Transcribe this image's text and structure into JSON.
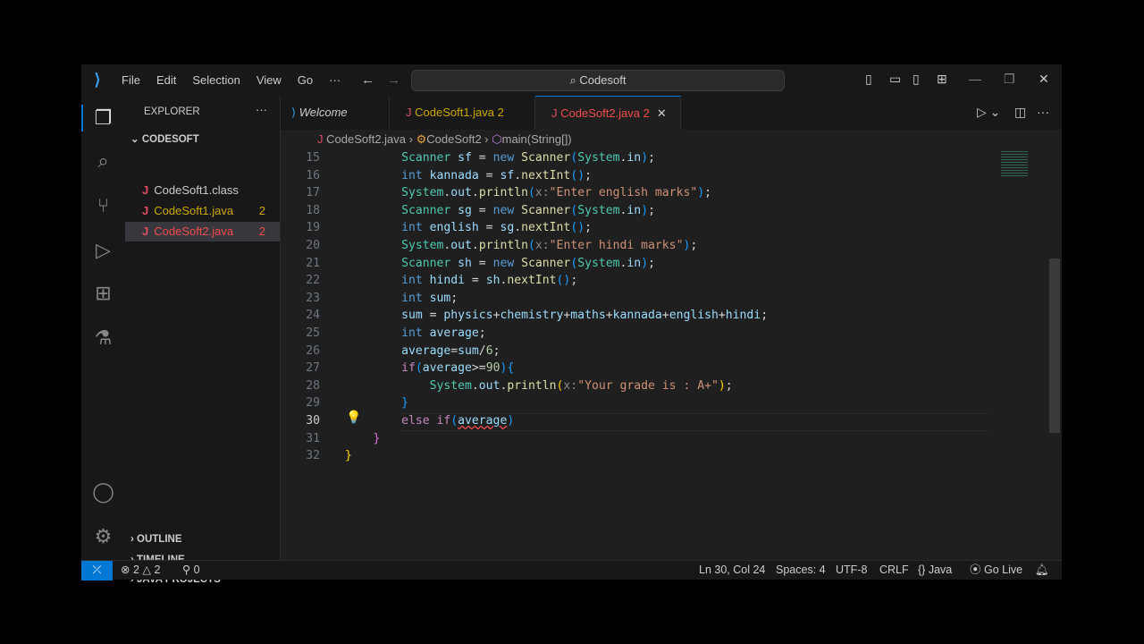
{
  "title_bar": {
    "menus": [
      "File",
      "Edit",
      "Selection",
      "View",
      "Go",
      "···"
    ],
    "search": "Codesoft"
  },
  "sidebar": {
    "title": "EXPLORER",
    "folder": "CODESOFT",
    "files": [
      {
        "name": "CodeSoft1.class",
        "badge": "",
        "color": "#cccccc"
      },
      {
        "name": "CodeSoft1.java",
        "badge": "2",
        "color": "#cca700"
      },
      {
        "name": "CodeSoft2.java",
        "badge": "2",
        "color": "#f14c4c",
        "selected": true
      }
    ],
    "sections": [
      "OUTLINE",
      "TIMELINE",
      "JAVA PROJECTS"
    ]
  },
  "tabs": [
    {
      "label": "Welcome",
      "badge": ""
    },
    {
      "label": "CodeSoft1.java",
      "badge": "2"
    },
    {
      "label": "CodeSoft2.java",
      "badge": "2"
    }
  ],
  "breadcrumb": {
    "file": "CodeSoft2.java",
    "cls": "CodeSoft2",
    "method": "main(String[])"
  },
  "editor": {
    "current_line": 30,
    "lines": [
      {
        "n": "15",
        "t": [
          [
            "ty",
            "        Scanner "
          ],
          [
            "va",
            "sf"
          ],
          [
            "pl",
            " = "
          ],
          [
            "kw",
            "new "
          ],
          [
            "fn",
            "Scanner"
          ],
          [
            "br3",
            "("
          ],
          [
            "ty",
            "System"
          ],
          [
            "pl",
            "."
          ],
          [
            "va",
            "in"
          ],
          [
            "br3",
            ")"
          ],
          [
            "pl",
            ";"
          ]
        ]
      },
      {
        "n": "16",
        "t": [
          [
            "kw",
            "        int "
          ],
          [
            "va",
            "kannada"
          ],
          [
            "pl",
            " = "
          ],
          [
            "va",
            "sf"
          ],
          [
            "pl",
            "."
          ],
          [
            "fn",
            "nextInt"
          ],
          [
            "br3",
            "()"
          ],
          [
            "pl",
            ";"
          ]
        ]
      },
      {
        "n": "17",
        "t": [
          [
            "ty",
            "        System"
          ],
          [
            "pl",
            "."
          ],
          [
            "va",
            "out"
          ],
          [
            "pl",
            "."
          ],
          [
            "fn",
            "println"
          ],
          [
            "br3",
            "("
          ],
          [
            "hint",
            "x:"
          ],
          [
            "st",
            "\"Enter english marks\""
          ],
          [
            "br3",
            ")"
          ],
          [
            "pl",
            ";"
          ]
        ]
      },
      {
        "n": "18",
        "t": [
          [
            "ty",
            "        Scanner "
          ],
          [
            "va",
            "sg"
          ],
          [
            "pl",
            " = "
          ],
          [
            "kw",
            "new "
          ],
          [
            "fn",
            "Scanner"
          ],
          [
            "br3",
            "("
          ],
          [
            "ty",
            "System"
          ],
          [
            "pl",
            "."
          ],
          [
            "va",
            "in"
          ],
          [
            "br3",
            ")"
          ],
          [
            "pl",
            ";"
          ]
        ]
      },
      {
        "n": "19",
        "t": [
          [
            "kw",
            "        int "
          ],
          [
            "va",
            "english"
          ],
          [
            "pl",
            " = "
          ],
          [
            "va",
            "sg"
          ],
          [
            "pl",
            "."
          ],
          [
            "fn",
            "nextInt"
          ],
          [
            "br3",
            "()"
          ],
          [
            "pl",
            ";"
          ]
        ]
      },
      {
        "n": "20",
        "t": [
          [
            "ty",
            "        System"
          ],
          [
            "pl",
            "."
          ],
          [
            "va",
            "out"
          ],
          [
            "pl",
            "."
          ],
          [
            "fn",
            "println"
          ],
          [
            "br3",
            "("
          ],
          [
            "hint",
            "x:"
          ],
          [
            "st",
            "\"Enter hindi marks\""
          ],
          [
            "br3",
            ")"
          ],
          [
            "pl",
            ";"
          ]
        ]
      },
      {
        "n": "21",
        "t": [
          [
            "ty",
            "        Scanner "
          ],
          [
            "va",
            "sh"
          ],
          [
            "pl",
            " = "
          ],
          [
            "kw",
            "new "
          ],
          [
            "fn",
            "Scanner"
          ],
          [
            "br3",
            "("
          ],
          [
            "ty",
            "System"
          ],
          [
            "pl",
            "."
          ],
          [
            "va",
            "in"
          ],
          [
            "br3",
            ")"
          ],
          [
            "pl",
            ";"
          ]
        ]
      },
      {
        "n": "22",
        "t": [
          [
            "kw",
            "        int "
          ],
          [
            "va",
            "hindi"
          ],
          [
            "pl",
            " = "
          ],
          [
            "va",
            "sh"
          ],
          [
            "pl",
            "."
          ],
          [
            "fn",
            "nextInt"
          ],
          [
            "br3",
            "()"
          ],
          [
            "pl",
            ";"
          ]
        ]
      },
      {
        "n": "23",
        "t": [
          [
            "kw",
            "        int "
          ],
          [
            "va",
            "sum"
          ],
          [
            "pl",
            ";"
          ]
        ]
      },
      {
        "n": "24",
        "t": [
          [
            "va",
            "        sum"
          ],
          [
            "pl",
            " = "
          ],
          [
            "va",
            "physics"
          ],
          [
            "pl",
            "+"
          ],
          [
            "va",
            "chemistry"
          ],
          [
            "pl",
            "+"
          ],
          [
            "va",
            "maths"
          ],
          [
            "pl",
            "+"
          ],
          [
            "va",
            "kannada"
          ],
          [
            "pl",
            "+"
          ],
          [
            "va",
            "english"
          ],
          [
            "pl",
            "+"
          ],
          [
            "va",
            "hindi"
          ],
          [
            "pl",
            ";"
          ]
        ]
      },
      {
        "n": "25",
        "t": [
          [
            "kw",
            "        int "
          ],
          [
            "va",
            "average"
          ],
          [
            "pl",
            ";"
          ]
        ]
      },
      {
        "n": "26",
        "t": [
          [
            "va",
            "        average"
          ],
          [
            "pl",
            "="
          ],
          [
            "va",
            "sum"
          ],
          [
            "pl",
            "/"
          ],
          [
            "nu",
            "6"
          ],
          [
            "pl",
            ";"
          ]
        ]
      },
      {
        "n": "27",
        "t": [
          [
            "ctl",
            "        if"
          ],
          [
            "br3",
            "("
          ],
          [
            "va",
            "average"
          ],
          [
            "pl",
            ">="
          ],
          [
            "nu",
            "90"
          ],
          [
            "br3",
            ")"
          ],
          [
            "br3",
            "{"
          ]
        ]
      },
      {
        "n": "28",
        "t": [
          [
            "ty",
            "            System"
          ],
          [
            "pl",
            "."
          ],
          [
            "va",
            "out"
          ],
          [
            "pl",
            "."
          ],
          [
            "fn",
            "println"
          ],
          [
            "br1",
            "("
          ],
          [
            "hint",
            "x:"
          ],
          [
            "st",
            "\"Your grade is : A+\""
          ],
          [
            "br1",
            ")"
          ],
          [
            "pl",
            ";"
          ]
        ]
      },
      {
        "n": "29",
        "t": [
          [
            "br3",
            "        }"
          ]
        ]
      },
      {
        "n": "30",
        "t": [
          [
            "ctl",
            "        else if"
          ],
          [
            "br3",
            "("
          ],
          [
            "va err",
            "average"
          ],
          [
            "br3",
            ")"
          ]
        ]
      },
      {
        "n": "31",
        "t": [
          [
            "br2",
            "    }"
          ]
        ]
      },
      {
        "n": "32",
        "t": [
          [
            "br1",
            "}"
          ]
        ]
      }
    ]
  },
  "status": {
    "errors": "2",
    "warnings": "2",
    "ports": "0",
    "position": "Ln 30, Col 24",
    "spaces": "Spaces: 4",
    "encoding": "UTF-8",
    "eol": "CRLF",
    "language": "Java",
    "golive": "Go Live"
  }
}
